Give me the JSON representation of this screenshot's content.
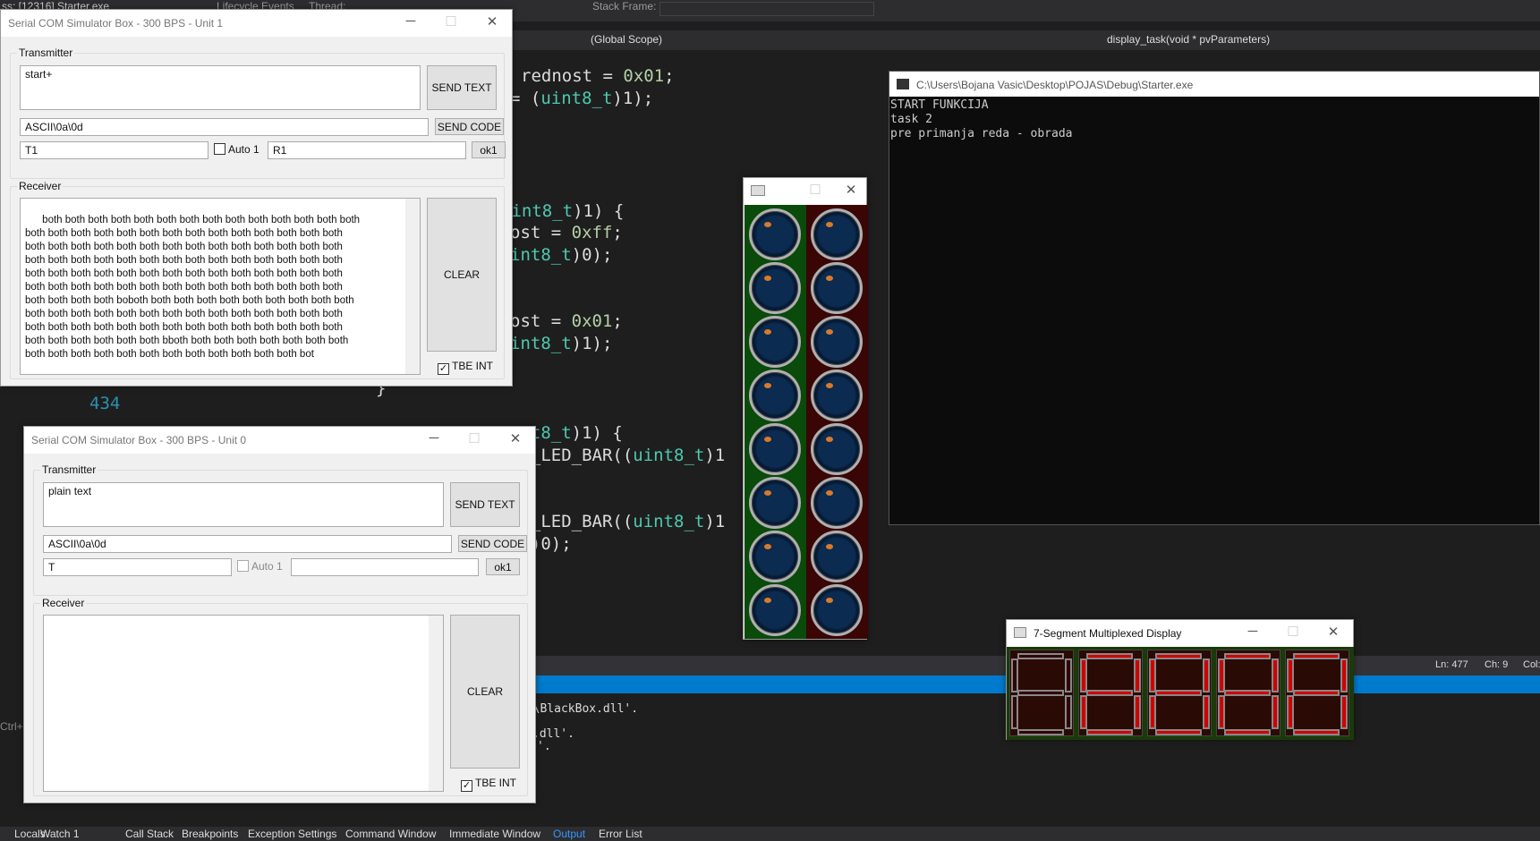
{
  "vs": {
    "top_left": "ss:  [12316] Starter.exe",
    "lifecycle": "Lifecycle Events",
    "thread": "Thread:",
    "stack_frame": "Stack Frame:",
    "scope": "(Global Scope)",
    "function": "display_task(void * pvParameters)",
    "code_lines": [
      {
        "parts": [
          {
            "t": "rednost = ",
            "c": ""
          },
          {
            "t": "0x01",
            "c": "num"
          },
          {
            "t": ";",
            "c": ""
          }
        ]
      },
      {
        "parts": [
          {
            "t": "= (",
            "c": ""
          },
          {
            "t": "uint8_t",
            "c": "kw"
          },
          {
            "t": ")1);",
            "c": ""
          }
        ]
      },
      {
        "parts": [
          {
            "t": "uint8_t",
            "c": "kw"
          },
          {
            "t": ")1) {",
            "c": ""
          }
        ]
      },
      {
        "parts": [
          {
            "t": "ost = ",
            "c": ""
          },
          {
            "t": "0xff",
            "c": "num"
          },
          {
            "t": ";",
            "c": ""
          }
        ]
      },
      {
        "parts": [
          {
            "t": "int8_t",
            "c": "kw"
          },
          {
            "t": ")0);",
            "c": ""
          }
        ]
      },
      {
        "parts": [
          {
            "t": "ost = ",
            "c": ""
          },
          {
            "t": "0x01",
            "c": "num"
          },
          {
            "t": ";",
            "c": ""
          }
        ]
      },
      {
        "parts": [
          {
            "t": "int8_t",
            "c": "kw"
          },
          {
            "t": ")1);",
            "c": ""
          }
        ]
      },
      {
        "parts": [
          {
            "t": "}",
            "c": ""
          }
        ]
      },
      {
        "parts": [
          {
            "t": "int8_t",
            "c": "kw"
          },
          {
            "t": ")1) {",
            "c": ""
          }
        ]
      },
      {
        "parts": [
          {
            "t": "et_LED_BAR((",
            "c": ""
          },
          {
            "t": "uint8_t",
            "c": "kw"
          },
          {
            "t": ")1",
            "c": ""
          }
        ]
      },
      {
        "parts": [
          {
            "t": "et_LED_BAR((",
            "c": ""
          },
          {
            "t": "uint8_t",
            "c": "kw"
          },
          {
            "t": ")1",
            "c": ""
          }
        ]
      },
      {
        "parts": [
          {
            "t": "_t)0);",
            "c": ""
          }
        ]
      }
    ],
    "line_number": "434",
    "status_ln": "Ln: 477",
    "status_ch": "Ch: 9",
    "status_col": "Col:",
    "output_lines": [
      "AS\\BlackBox.dll'.",
      ".dll'.",
      "'."
    ],
    "ctrl_text": "Ctrl+",
    "bottom_tabs": [
      "Locals",
      "Watch 1",
      "Call Stack",
      "Breakpoints",
      "Exception Settings",
      "Command Window",
      "Immediate Window",
      "Output",
      "Error List"
    ]
  },
  "console": {
    "title": "C:\\Users\\Bojana Vasic\\Desktop\\POJAS\\Debug\\Starter.exe",
    "lines": [
      "START FUNKCIJA",
      "task 2",
      "pre primanja reda - obrada"
    ]
  },
  "serial1": {
    "title": "Serial COM Simulator Box - 300 BPS - Unit 1",
    "transmitter_label": "Transmitter",
    "tx_text": "start+",
    "send_text": "SEND TEXT",
    "code_value": "ASCII\\0a\\0d",
    "send_code": "SEND CODE",
    "t_value": "T1",
    "auto_label": "Auto 1",
    "r_value": "R1",
    "ok_label": "ok1",
    "receiver_label": "Receiver",
    "rx_text": "both both both both both both both both both both both both both both\nboth both both both both both both both both both both both both both\nboth both both both both both both both both both both both both both\nboth both both both both both both both both both both both both both\nboth both both both both both both both both both both both both both\nboth both both both both both both both both both both both both both\nboth both both both boboth both both both both both both both both both\nboth both both both both both both both both both both both both both\nboth both both both both both both both both both both both both both\nboth both both both both both bboth both both both both both both both\nboth both both both both both both both both both both both bot",
    "clear": "CLEAR",
    "tbe_label": "TBE INT"
  },
  "serial0": {
    "title": "Serial COM Simulator Box - 300 BPS - Unit 0",
    "transmitter_label": "Transmitter",
    "tx_text": "plain text",
    "send_text": "SEND TEXT",
    "code_value": "ASCII\\0a\\0d",
    "send_code": "SEND CODE",
    "t_value": "T",
    "auto_label": "Auto 1",
    "r_value": "",
    "ok_label": "ok1",
    "receiver_label": "Receiver",
    "rx_text": "",
    "clear": "CLEAR",
    "tbe_label": "TBE INT"
  },
  "seg_title": "7-Segment Multiplexed Display",
  "colors": {
    "accent": "#007acc",
    "led_left_bg": "#0a4a0a",
    "led_right_bg": "#3a0505",
    "seg_on": "#d00000"
  }
}
